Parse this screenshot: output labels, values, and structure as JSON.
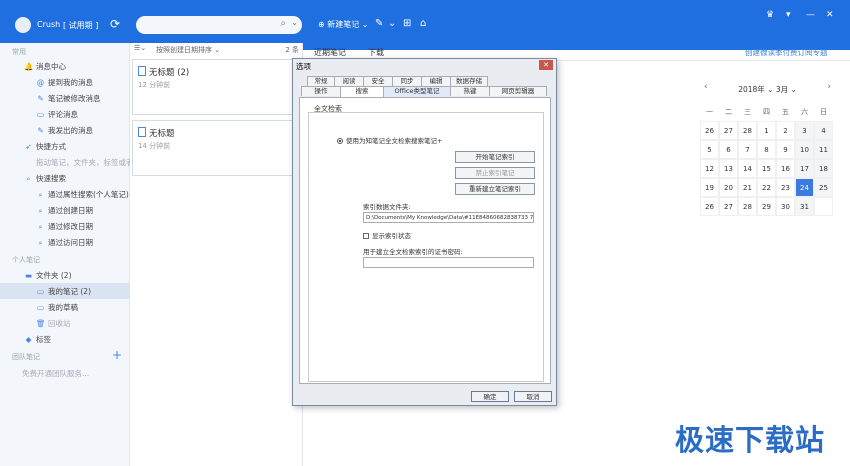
{
  "header": {
    "app_name": "Crush",
    "trial": "[ 试用期 ]",
    "search_placeholder": "",
    "new_note": "新建笔记"
  },
  "sidebar": {
    "section_common": "常用",
    "messages": "消息中心",
    "mention": "提到我的消息",
    "modified": "笔记被修改消息",
    "comments": "评论消息",
    "sent": "我发出的消息",
    "shortcuts": "快捷方式",
    "shortcut_hint": "拖动笔记，文件夹，标签或者...",
    "quick_search": "快速搜索",
    "by_attr": "通过属性搜索(个人笔记)",
    "by_created": "通过创建日期",
    "by_modified": "通过修改日期",
    "by_accessed": "通过访问日期",
    "section_personal": "个人笔记",
    "folders": "文件夹 (2)",
    "my_notes": "我的笔记 (2)",
    "drafts": "我的草稿",
    "recycle": "回收站",
    "tags": "标签",
    "section_team": "团队笔记",
    "team_hint": "免费开通团队服务..."
  },
  "list": {
    "sort_label": "按照创建日期排序",
    "count": "2 条",
    "notes": [
      {
        "title": "无标题 (2)",
        "time": "12 分钟前"
      },
      {
        "title": "无标题",
        "time": "14 分钟前"
      }
    ]
  },
  "main": {
    "tab_recent": "近期笔记",
    "tab_download": "下载",
    "subscribe_link": "创建微读季付费订阅专题"
  },
  "calendar": {
    "year": "2018年",
    "month": "3月",
    "weekdays": [
      "一",
      "二",
      "三",
      "四",
      "五",
      "六",
      "日"
    ],
    "days": [
      "26",
      "27",
      "28",
      "1",
      "2",
      "3",
      "4",
      "5",
      "6",
      "7",
      "8",
      "9",
      "10",
      "11",
      "12",
      "13",
      "14",
      "15",
      "16",
      "17",
      "18",
      "19",
      "20",
      "21",
      "22",
      "23",
      "24",
      "25",
      "26",
      "27",
      "28",
      "29",
      "30",
      "31",
      ""
    ],
    "today": "24"
  },
  "dialog": {
    "title": "选项",
    "tabs_row1": [
      "常规",
      "阅读",
      "安全",
      "同步",
      "编辑",
      "数据存储"
    ],
    "tabs_row2": [
      "操作",
      "搜索",
      "Office类型笔记",
      "热键",
      "网页剪辑器"
    ],
    "group_label": "全文检索",
    "radio_label": "使用为知笔记全文检索搜索笔记+",
    "btn_start": "开始笔记索引",
    "btn_disable": "禁止索引笔记",
    "btn_rebuild": "重新建立笔记索引",
    "index_folder_label": "索引数据文件夹:",
    "index_folder_value": "D:\\Documents\\My Knowledge\\Data\\#11E84860682838733 7C96(",
    "show_status": "显示索引状态",
    "cert_label": "用于建立全文检索索引的证书密码:",
    "ok": "确定",
    "cancel": "取消"
  },
  "watermark": "极速下载站"
}
